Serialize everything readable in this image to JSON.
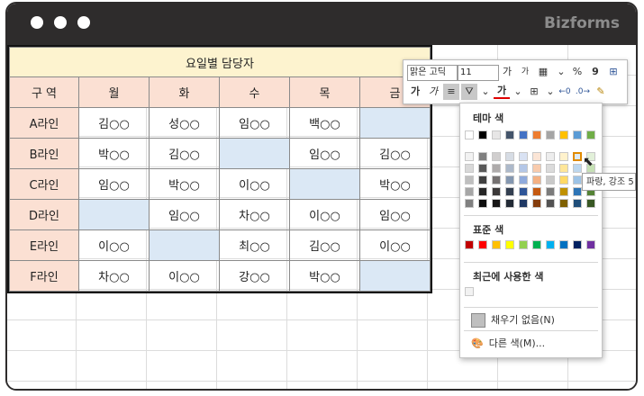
{
  "window": {
    "brand": "Bizforms"
  },
  "sheet": {
    "title": "요일별 담당자",
    "headers": [
      "구  역",
      "월",
      "화",
      "수",
      "목",
      "금"
    ],
    "rows": [
      [
        "A라인",
        "김○○",
        "성○○",
        "임○○",
        "백○○",
        ""
      ],
      [
        "B라인",
        "박○○",
        "김○○",
        "",
        "임○○",
        "김○○"
      ],
      [
        "C라인",
        "임○○",
        "박○○",
        "이○○",
        "",
        "박○○"
      ],
      [
        "D라인",
        "",
        "임○○",
        "차○○",
        "이○○",
        "임○○"
      ],
      [
        "E라인",
        "이○○",
        "",
        "최○○",
        "김○○",
        "이○○"
      ],
      [
        "F라인",
        "차○○",
        "이○○",
        "강○○",
        "박○○",
        ""
      ]
    ]
  },
  "toolbar": {
    "font_name": "맑은 고딕",
    "font_size": "11",
    "grow_font": "가",
    "shrink_font": "가",
    "percent": "%",
    "comma": "9",
    "bold": "가",
    "italic": "가",
    "font_color": "가"
  },
  "palette": {
    "theme_label": "테마 색",
    "standard_label": "표준 색",
    "recent_label": "최근에 사용한 색",
    "no_fill_label": "채우기 없음(N)",
    "more_colors_label": "다른 색(M)...",
    "tooltip": "파랑, 강조 5",
    "theme_top": [
      "#ffffff",
      "#000000",
      "#e7e6e6",
      "#44546a",
      "#4472c4",
      "#ed7d31",
      "#a5a5a5",
      "#ffc000",
      "#5b9bd5",
      "#70ad47"
    ],
    "theme_shades": [
      [
        "#f2f2f2",
        "#808080",
        "#d0cece",
        "#d6dce4",
        "#d9e2f3",
        "#fbe5d6",
        "#ededed",
        "#fff2cc",
        "#deebf7",
        "#e2f0d9"
      ],
      [
        "#d9d9d9",
        "#595959",
        "#aeabab",
        "#adb9ca",
        "#b4c7e7",
        "#f8cbad",
        "#dbdbdb",
        "#ffe699",
        "#bdd7ee",
        "#c5e0b4"
      ],
      [
        "#bfbfbf",
        "#404040",
        "#757171",
        "#8497b0",
        "#8faadc",
        "#f4b183",
        "#c9c9c9",
        "#ffd966",
        "#9dc3e6",
        "#a9d18e"
      ],
      [
        "#a6a6a6",
        "#262626",
        "#3b3838",
        "#333f50",
        "#2f5597",
        "#c55a11",
        "#7b7b7b",
        "#bf9000",
        "#2e75b6",
        "#548235"
      ],
      [
        "#808080",
        "#0d0d0d",
        "#171616",
        "#222a35",
        "#1f3864",
        "#843c0c",
        "#525252",
        "#7f6000",
        "#1f4e79",
        "#385723"
      ]
    ],
    "standard": [
      "#c00000",
      "#ff0000",
      "#ffc000",
      "#ffff00",
      "#92d050",
      "#00b050",
      "#00b0f0",
      "#0070c0",
      "#002060",
      "#7030a0"
    ],
    "recent": [
      "#f2f2f2"
    ]
  }
}
